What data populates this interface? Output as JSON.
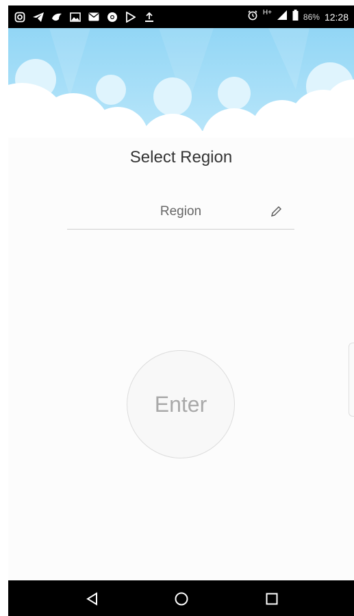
{
  "status_bar": {
    "left_icons": [
      "instagram-icon",
      "telegram-icon",
      "bird-app-icon",
      "image-icon",
      "mail-icon",
      "chrome-icon",
      "play-icon",
      "upload-icon"
    ],
    "alarm_icon": "alarm-icon",
    "network_label": "H+",
    "battery_percent": "86%",
    "time": "12:28"
  },
  "page": {
    "title": "Select Region",
    "region_field": {
      "value": "Region",
      "edit_icon": "pencil-icon"
    },
    "enter_button": "Enter"
  },
  "nav_bar": {
    "buttons": [
      "back",
      "home",
      "recents"
    ]
  },
  "colors": {
    "sky": "#9fdcf6",
    "sky_light": "#c6ebfb",
    "cloud": "#ffffff",
    "background": "#fcfcfc"
  }
}
